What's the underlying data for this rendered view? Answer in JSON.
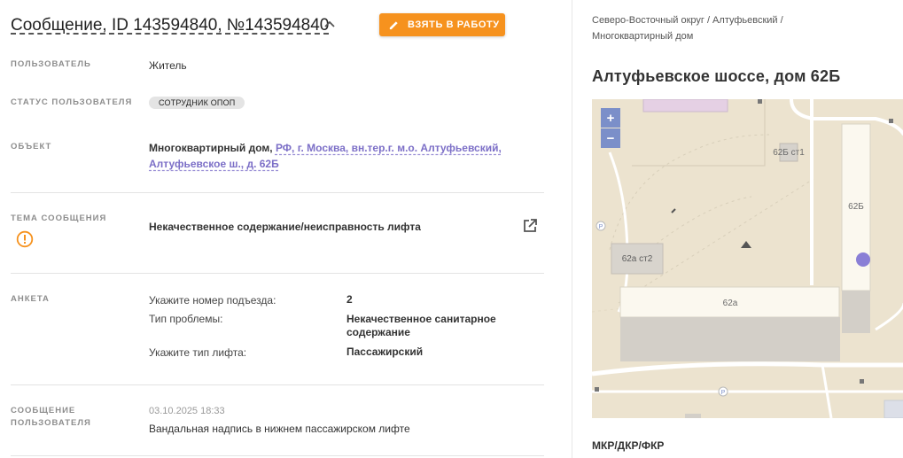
{
  "header": {
    "title": "Сообщение, ID 143594840, №143594840",
    "take_button": "ВЗЯТЬ В РАБОТУ"
  },
  "fields": {
    "user_label": "ПОЛЬЗОВАТЕЛЬ",
    "user_value": "Житель",
    "status_label": "СТАТУС ПОЛЬЗОВАТЕЛЯ",
    "status_value": "СОТРУДНИК ОПОП",
    "object_label": "ОБЪЕКТ",
    "object_type": "Многоквартирный дом,",
    "object_link_1": "РФ, г. Москва, вн.тер.г. м.о. Алтуфьевский,",
    "object_link_2": "Алтуфьевское ш., д. 62Б",
    "topic_label": "ТЕМА СООБЩЕНИЯ",
    "topic_value": "Некачественное содержание/неисправность лифта",
    "survey_label": "АНКЕТА",
    "survey": [
      {
        "q": "Укажите номер подъезда:",
        "a": "2"
      },
      {
        "q": "Тип проблемы:",
        "a1": "Некачественное санитарное",
        "a2": "содержание"
      },
      {
        "q": "Укажите тип лифта:",
        "a": "Пассажирский"
      }
    ],
    "message_label_1": "СООБЩЕНИЕ",
    "message_label_2": "ПОЛЬЗОВАТЕЛЯ",
    "message_date": "03.10.2025 18:33",
    "message_text": "Вандальная надпись в нижнем пассажирском лифте"
  },
  "right": {
    "breadcrumb_1": "Северо-Восточный округ / Алтуфьевский /",
    "breadcrumb_2": "Многоквартирный дом",
    "address": "Алтуфьевское шоссе, дом 62Б",
    "map": {
      "zoom_in": "+",
      "zoom_out": "−",
      "labels": {
        "b62b_st1": "62Б ст1",
        "b62b": "62Б",
        "b62a_st2": "62а ст2",
        "b62a": "62а",
        "parking": "P"
      },
      "marker_color": "#8a7fd6"
    },
    "section_title": "МКР/ДКР/ФКР"
  },
  "colors": {
    "accent": "#f6921e",
    "link": "#7c6fc7",
    "warning": "#f6921e"
  }
}
